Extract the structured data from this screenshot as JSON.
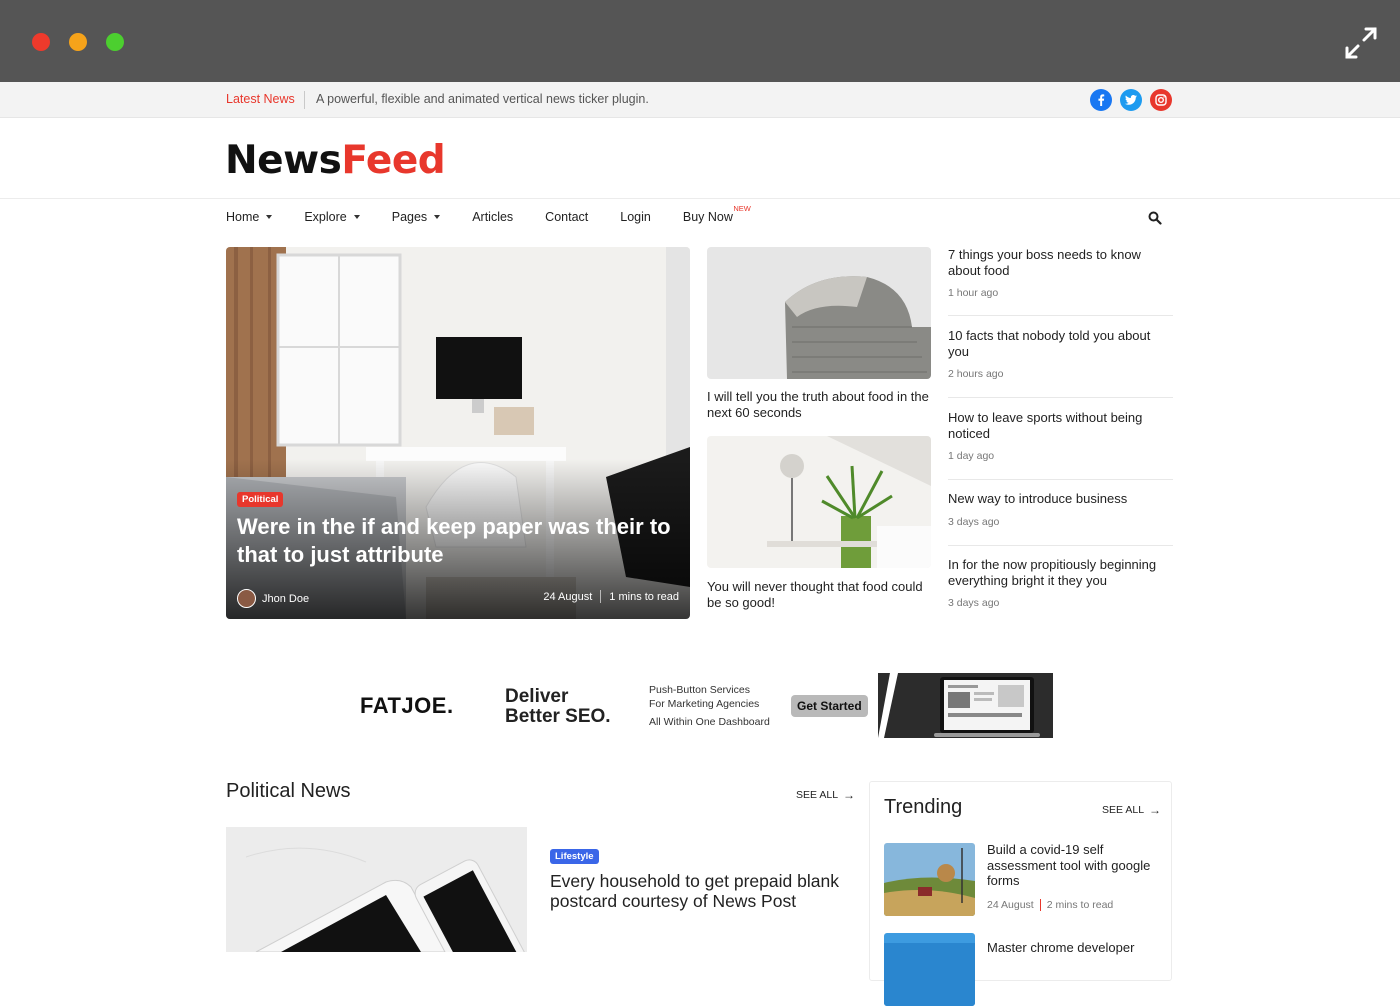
{
  "colors": {
    "accent": "#e8372c",
    "facebook": "#1877f2",
    "twitter": "#1d9bf0",
    "instagram": "#e8372c",
    "lifestyle": "#3a66e8",
    "chrome": "#555555"
  },
  "ticker": {
    "label": "Latest News",
    "text": "A powerful, flexible and animated vertical news ticker plugin."
  },
  "logo": {
    "part1": "News",
    "part2": "Feed"
  },
  "nav": {
    "items": [
      {
        "label": "Home"
      },
      {
        "label": "Explore"
      },
      {
        "label": "Pages"
      },
      {
        "label": "Articles"
      },
      {
        "label": "Contact"
      },
      {
        "label": "Login"
      },
      {
        "label": "Buy Now",
        "tag": "NEW"
      }
    ]
  },
  "hero": {
    "category": "Political",
    "title": "Were in the if and keep paper was their to that to just attribute",
    "author": "Jhon Doe",
    "date": "24 August",
    "read_time": "1 mins to read"
  },
  "middle": [
    {
      "title": "I will tell you the truth about food in the next 60 seconds"
    },
    {
      "title": "You will never thought that food could be so good!"
    }
  ],
  "right_list": [
    {
      "title": "7 things your boss needs to know about food",
      "time": "1 hour ago"
    },
    {
      "title": "10 facts that nobody told you about you",
      "time": "2 hours ago"
    },
    {
      "title": "How to leave sports without being noticed",
      "time": "1 day ago"
    },
    {
      "title": "New way to introduce business",
      "time": "3 days ago"
    },
    {
      "title": "In for the now propitiously beginning everything bright it they you",
      "time": "3 days ago"
    }
  ],
  "ad": {
    "brand": "FATJOE.",
    "headline_1": "Deliver",
    "headline_2": "Better SEO.",
    "line1": "Push-Button Services",
    "line2": "For Marketing Agencies",
    "line3": "All Within One Dashboard",
    "button": "Get Started"
  },
  "political": {
    "heading": "Political News",
    "see_all": "SEE ALL",
    "category": "Lifestyle",
    "title": "Every household to get prepaid blank postcard courtesy of News Post"
  },
  "trending": {
    "heading": "Trending",
    "see_all": "SEE ALL",
    "items": [
      {
        "title": "Build a covid-19 self assessment tool with google forms",
        "date": "24 August",
        "read_time": "2 mins to read"
      },
      {
        "title": "Master chrome developer"
      }
    ]
  }
}
